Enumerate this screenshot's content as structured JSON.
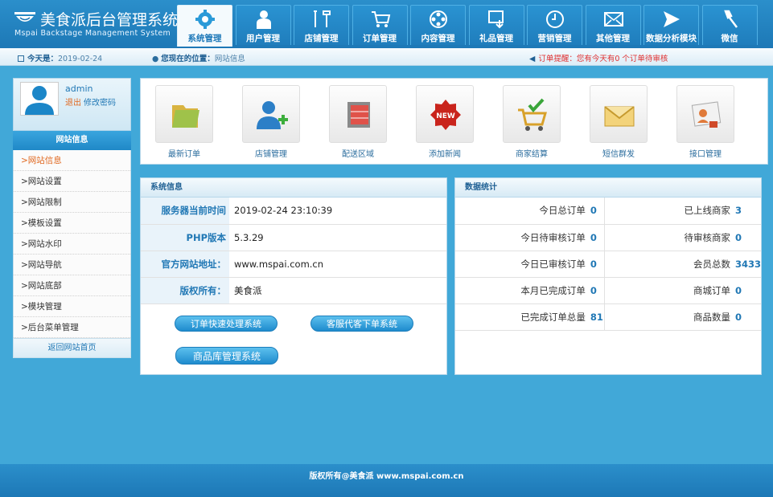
{
  "brand": {
    "title": "美食派后台管理系统",
    "subtitle": "Mspai Backstage Management System"
  },
  "nav": {
    "tabs": [
      {
        "label": "系统管理",
        "icon": "gear-icon"
      },
      {
        "label": "用户管理",
        "icon": "user-icon"
      },
      {
        "label": "店铺管理",
        "icon": "tools-icon"
      },
      {
        "label": "订单管理",
        "icon": "cart-icon"
      },
      {
        "label": "内容管理",
        "icon": "film-icon"
      },
      {
        "label": "礼品管理",
        "icon": "gift-box-icon"
      },
      {
        "label": "营销管理",
        "icon": "clock-icon"
      },
      {
        "label": "其他管理",
        "icon": "mail-icon"
      },
      {
        "label": "数据分析模块",
        "icon": "plane-icon"
      },
      {
        "label": "微信",
        "icon": "tool-icon"
      }
    ],
    "active_index": 0
  },
  "infobar": {
    "today_label": "今天是：",
    "today_value": "2019-02-24",
    "location_label": "您现在的位置：",
    "location_value": "网站信息",
    "alert_label": "订单提醒：",
    "alert_value": "您有今天有0 个订单待审核"
  },
  "user": {
    "name": "admin",
    "logout": "退出",
    "change_password": "修改密码"
  },
  "sidebar": {
    "title": "网站信息",
    "items": [
      {
        "label": ">网站信息",
        "active": true
      },
      {
        "label": ">网站设置",
        "active": false
      },
      {
        "label": ">网站限制",
        "active": false
      },
      {
        "label": ">模板设置",
        "active": false
      },
      {
        "label": ">网站水印",
        "active": false
      },
      {
        "label": ">网站导航",
        "active": false
      },
      {
        "label": ">网站底部",
        "active": false
      },
      {
        "label": ">模块管理",
        "active": false
      },
      {
        "label": ">后台菜单管理",
        "active": false
      }
    ],
    "back_link": "返回网站首页"
  },
  "quick": [
    {
      "label": "最新订单",
      "icon": "folder-icon"
    },
    {
      "label": "店铺管理",
      "icon": "add-user-icon"
    },
    {
      "label": "配送区域",
      "icon": "binder-icon"
    },
    {
      "label": "添加新闻",
      "icon": "new-badge-icon"
    },
    {
      "label": "商家结算",
      "icon": "cart-check-icon"
    },
    {
      "label": "短信群发",
      "icon": "envelope-icon"
    },
    {
      "label": "接口管理",
      "icon": "id-card-icon"
    }
  ],
  "sysinfo": {
    "title": "系统信息",
    "rows": [
      {
        "key": "服务器当前时间",
        "value": "2019-02-24 23:10:39"
      },
      {
        "key": "PHP版本",
        "value": "5.3.29"
      },
      {
        "key": "官方网站地址：",
        "value": "www.mspai.com.cn"
      },
      {
        "key": "版权所有：",
        "value": "美食派"
      }
    ],
    "buttons": {
      "quick_order": "订单快速处理系统",
      "service_order": "客服代客下单系统",
      "goods_library": "商品库管理系统"
    }
  },
  "stats": {
    "title": "数据统计",
    "rows": [
      {
        "k1": "今日总订单",
        "v1": "0",
        "k2": "已上线商家",
        "v2": "3"
      },
      {
        "k1": "今日待审核订单",
        "v1": "0",
        "k2": "待审核商家",
        "v2": "0"
      },
      {
        "k1": "今日已审核订单",
        "v1": "0",
        "k2": "会员总数",
        "v2": "3433"
      },
      {
        "k1": "本月已完成订单",
        "v1": "0",
        "k2": "商城订单",
        "v2": "0"
      },
      {
        "k1": "已完成订单总量",
        "v1": "81",
        "k2": "商品数量",
        "v2": "0"
      }
    ]
  },
  "footer": {
    "text": "版权所有@美食派 www.mspai.com.cn"
  },
  "colors": {
    "brand_blue": "#1d78b6",
    "background": "#41a8d8",
    "accent_orange": "#e06820",
    "alert_red": "#e03030"
  }
}
